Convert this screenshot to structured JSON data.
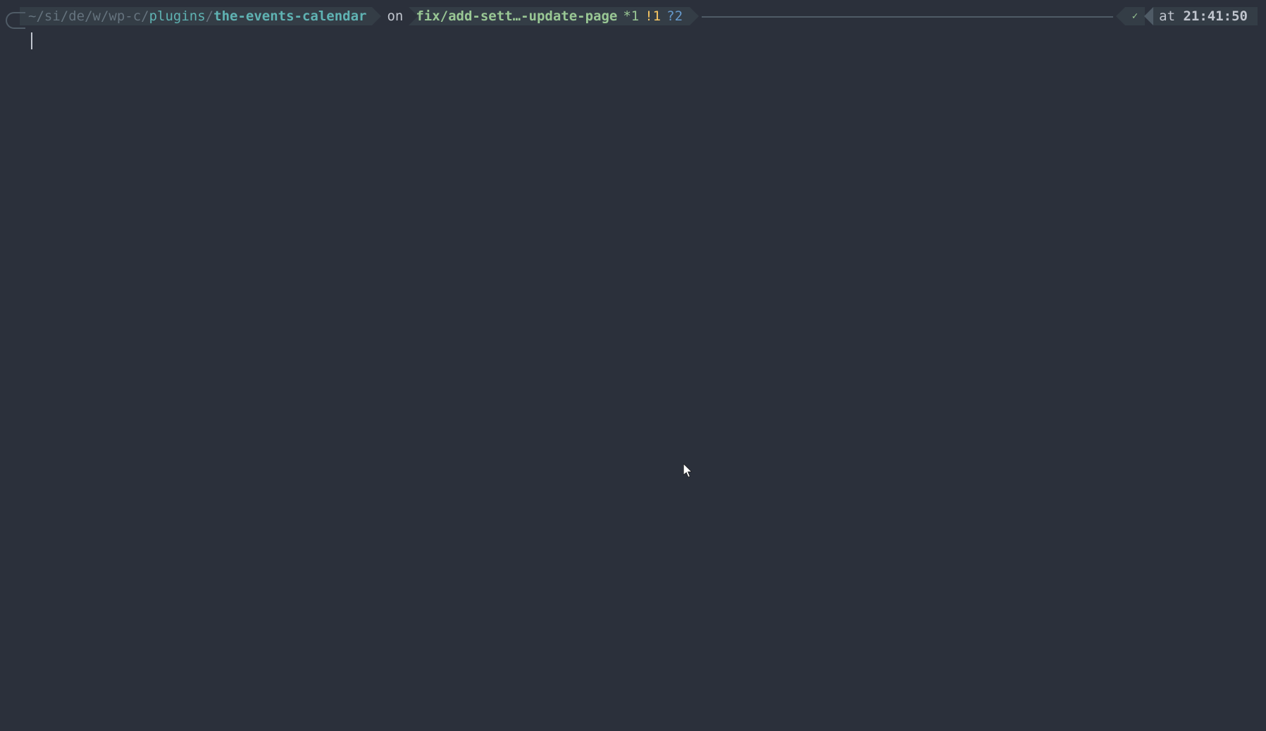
{
  "prompt": {
    "path": {
      "prefix": "~/si/de/w/wp-c/",
      "dir": "plugins",
      "sep": "/",
      "current": "the-events-calendar"
    },
    "on": "on",
    "branch": "fix/add-sett…-update-page",
    "git_status": {
      "staged": "*1",
      "modified": "!1",
      "untracked": "?2"
    },
    "check": "✓",
    "at": "at",
    "time": "21:41:50"
  }
}
